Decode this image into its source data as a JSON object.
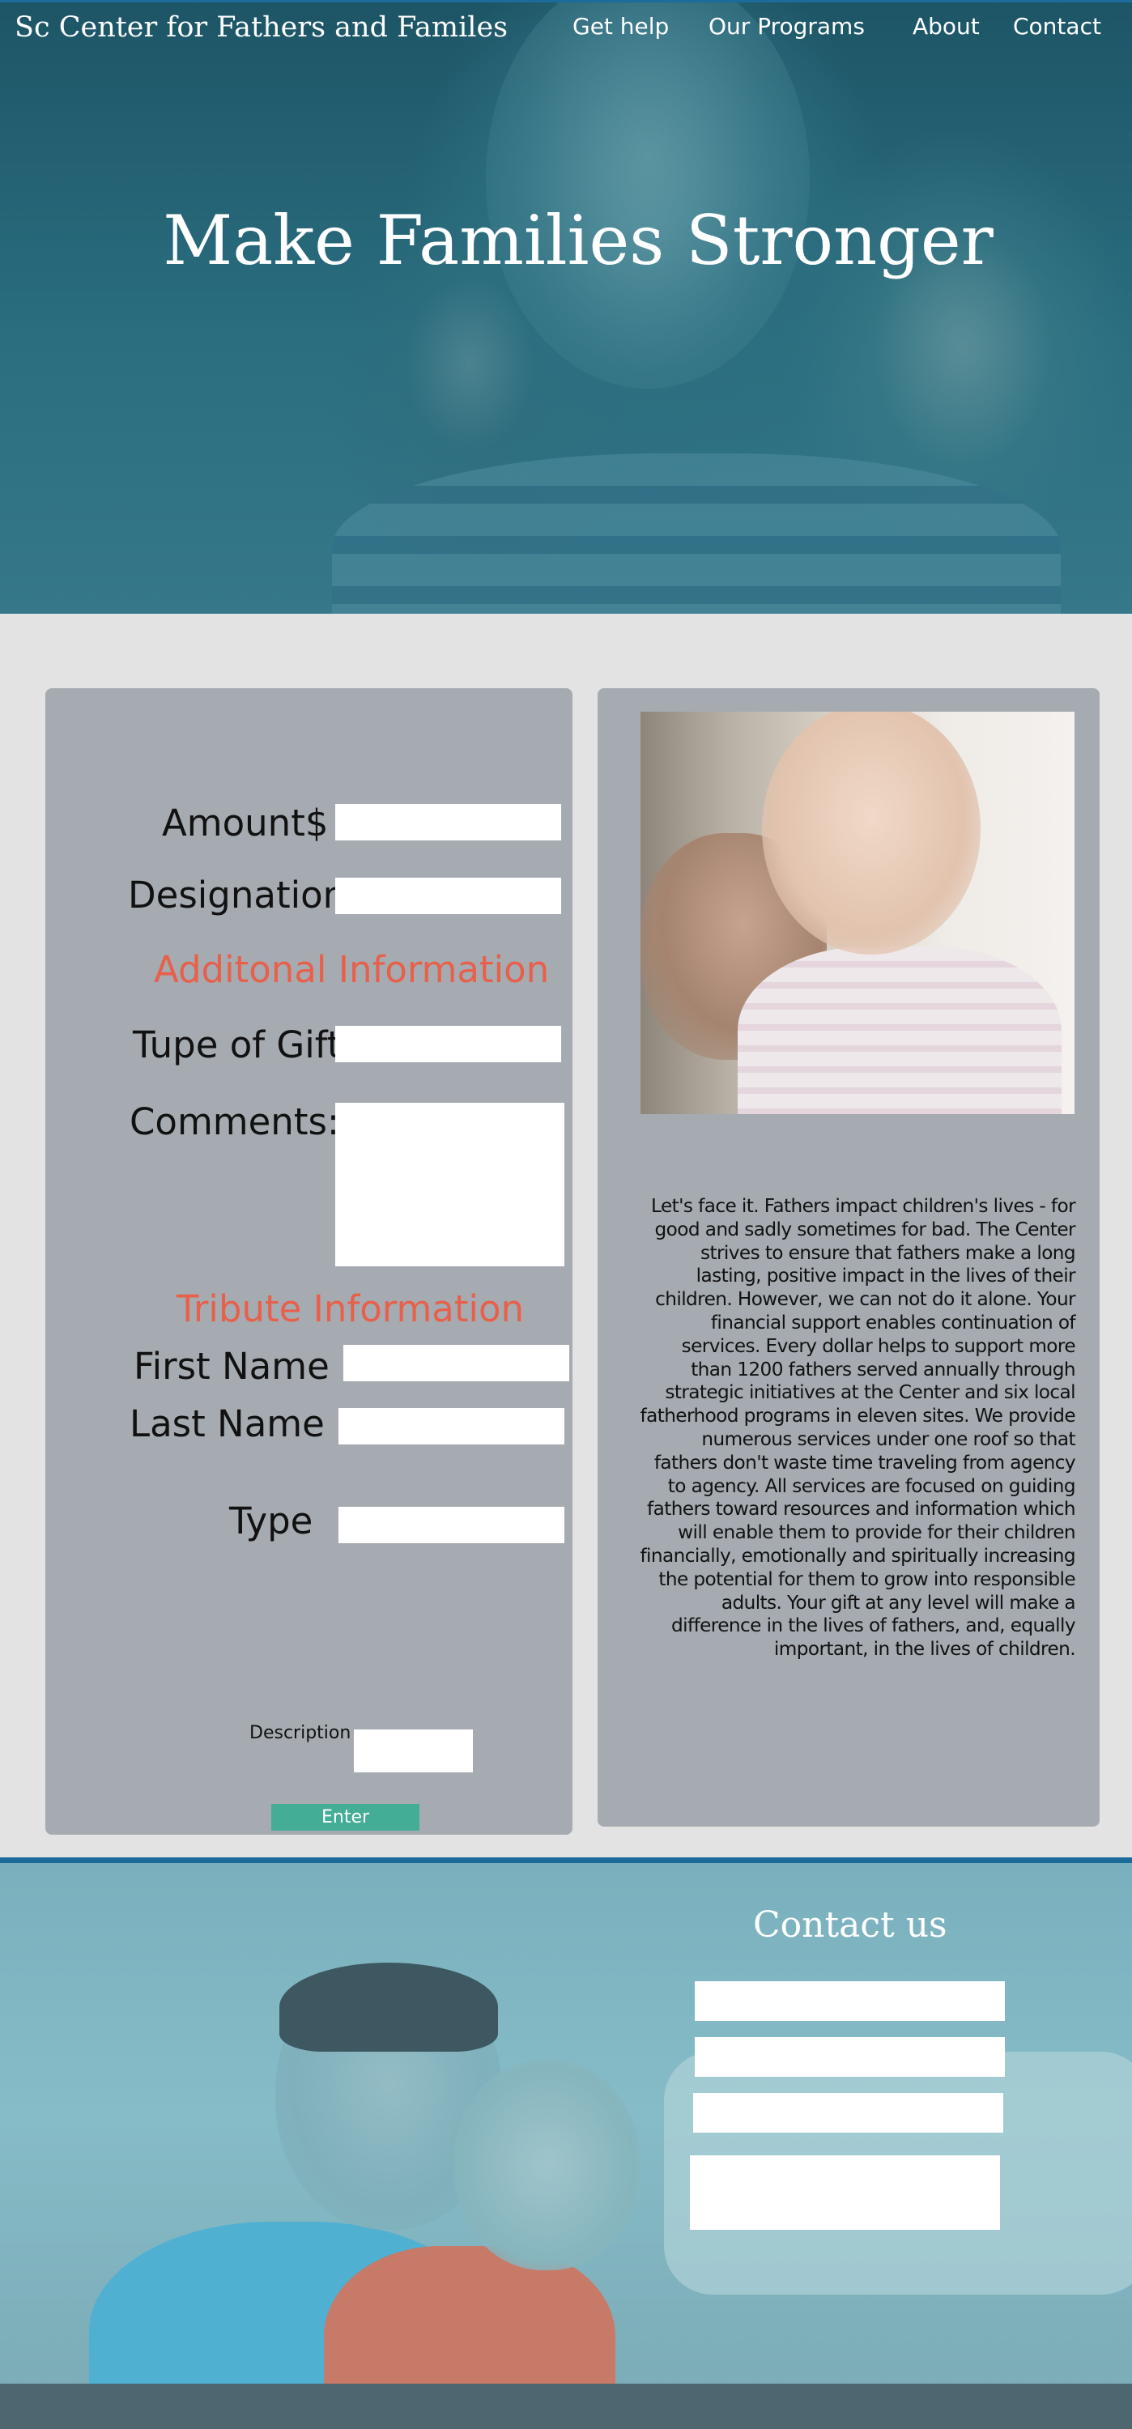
{
  "header": {
    "site_title": "Sc Center for Fathers and Familes",
    "nav": [
      "Get help",
      "Our Programs",
      "About",
      "Contact"
    ],
    "hero_heading": "Make Families Stronger"
  },
  "donation_form": {
    "amount_label": "Amount$",
    "designation_label": "Designation",
    "additional_heading": "Additonal Information",
    "type_of_gift_label": "Tupe of Gift",
    "comments_label": "Comments:",
    "tribute_heading": "Tribute Information",
    "first_name_label": "First Name",
    "last_name_label": "Last Name",
    "type_label": "Type",
    "description_label": "Description",
    "enter_button": "Enter"
  },
  "about": {
    "photo_icon": "father-baby-photo",
    "text": "Let's face it. Fathers impact children's lives - for good and sadly sometimes for bad.  The Center strives to ensure that fathers make a long lasting, positive impact in the lives of their children.  However, we can not do it alone. Your financial support enables continuation of services.  Every dollar helps to support more than 1200 fathers served annually through strategic initiatives at the Center and six local fatherhood programs in eleven sites. We provide numerous services under one roof so that fathers don't waste time traveling from agency to agency.  All services are focused on guiding fathers toward resources and information which will enable them to provide for their children financially, emotionally and spiritually increasing the potential for them to grow into responsible adults.  Your gift at any level will make a difference in the lives of fathers, and, equally important, in the lives of children."
  },
  "footer": {
    "contact_heading": "Contact us"
  },
  "colors": {
    "accent_heading": "#e8604a",
    "enter_button": "#44ad96",
    "panel": "#a5abb1",
    "top_line": "#1c6b9a"
  }
}
